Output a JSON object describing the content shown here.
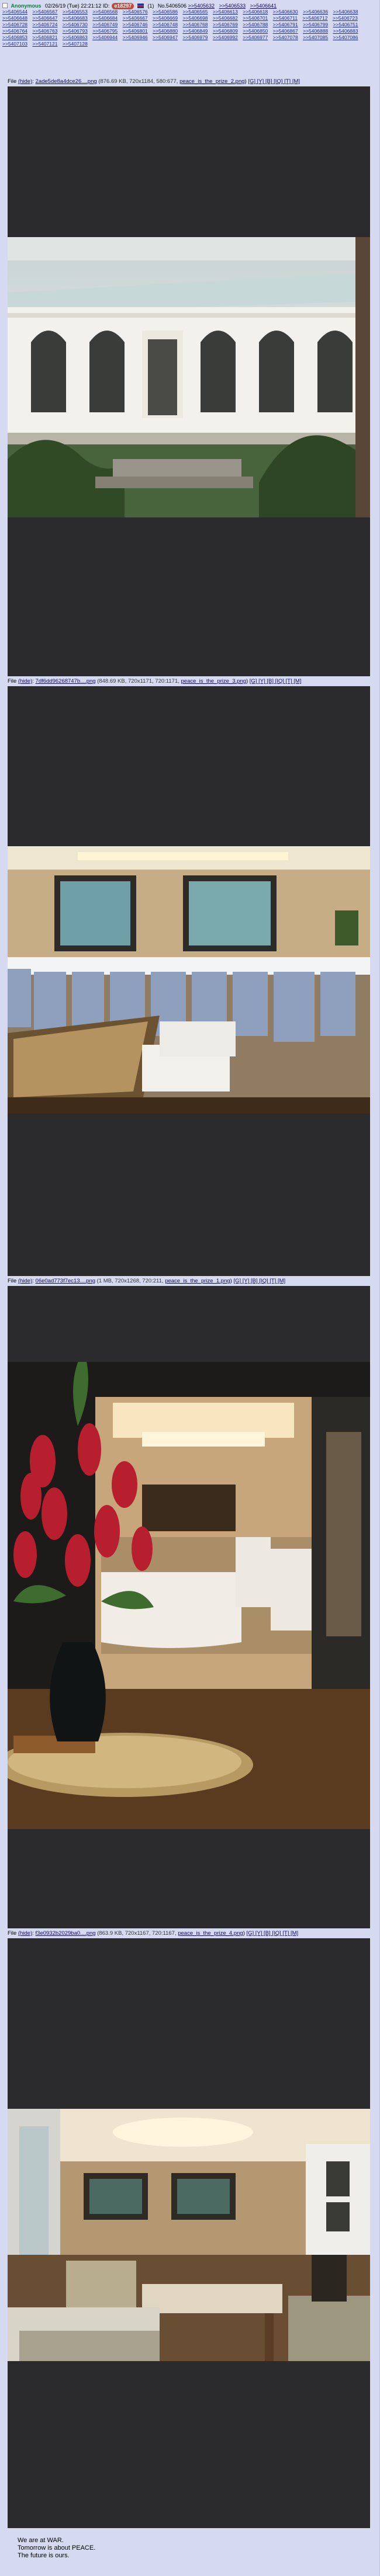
{
  "post": {
    "name": "Anonymous",
    "date": "02/26/19 (Tue) 22:21:12",
    "poster_id": "e18297",
    "reply_count": "(1)",
    "post_number": "No.5406506",
    "header_quotes": [
      ">>5405632",
      ">>5406533",
      ">>5406641"
    ],
    "backlinks": [
      ">>5406544",
      ">>5406567",
      ">>5406553",
      ">>5406568",
      ">>5406576",
      ">>5406586",
      ">>5406565",
      ">>5406613",
      ">>5406618",
      ">>5406630",
      ">>5406636",
      ">>5406638",
      ">>5406648",
      ">>5406647",
      ">>5406683",
      ">>5406684",
      ">>5406667",
      ">>5406669",
      ">>5406698",
      ">>5406682",
      ">>5406701",
      ">>5406711",
      ">>5406712",
      ">>5406723",
      ">>5406728",
      ">>5406724",
      ">>5406730",
      ">>5406749",
      ">>5406746",
      ">>5406748",
      ">>5406768",
      ">>5406769",
      ">>5406788",
      ">>5406791",
      ">>5406799",
      ">>5406751",
      ">>5406764",
      ">>5406763",
      ">>5406793",
      ">>5406795",
      ">>5406801",
      ">>5406880",
      ">>5406849",
      ">>5406809",
      ">>5406850",
      ">>5406867",
      ">>5406888",
      ">>5406883",
      ">>5406853",
      ">>5406821",
      ">>5406863",
      ">>5406944",
      ">>5406946",
      ">>5406947",
      ">>5406979",
      ">>5406992",
      ">>5406977",
      ">>5407078",
      ">>5407085",
      ">>5407086",
      ">>5407103",
      ">>5407121",
      ">>5407128"
    ],
    "files": [
      {
        "label": "File",
        "hide": "(hide)",
        "name": "2ade5de8a4dce26....png",
        "meta": "(876.69 KB, 720x1184, 580:677,",
        "original": "peace_is_the_prize_2.png",
        "tools": "[G] [Y] [B] [IQ] [T] [M]"
      },
      {
        "label": "File",
        "hide": "(hide)",
        "name": "7df6dd96268747b....png",
        "meta": "(848.69 KB, 720x1171, 720:1171,",
        "original": "peace_is_the_prize_3.png",
        "tools": "[G] [Y] [B] [IQ] [T] [M]"
      },
      {
        "label": "File",
        "hide": "(hide)",
        "name": "06e0ad773f7ec13....png",
        "meta": "(1 MB, 720x1268, 720:211,",
        "original": "peace_is_the_prize_1.png",
        "tools": "[G] [Y] [B] [IQ] [T] [M]"
      },
      {
        "label": "File",
        "hide": "(hide)",
        "name": "f3e0932b2029ba0....png",
        "meta": "(863.9 KB, 720x1167, 720:1167,",
        "original": "peace_is_the_prize_4.png",
        "tools": "[G] [Y] [B] [IQ] [T] [M]"
      }
    ],
    "message": [
      "We are at WAR.",
      "Tomorrow is about PEACE.",
      "The future is ours."
    ]
  },
  "colors": {
    "post_background": "#d6daf0",
    "name": "#117743",
    "link": "#0f0c5d",
    "image_letterbox": "#2b2a2c"
  }
}
